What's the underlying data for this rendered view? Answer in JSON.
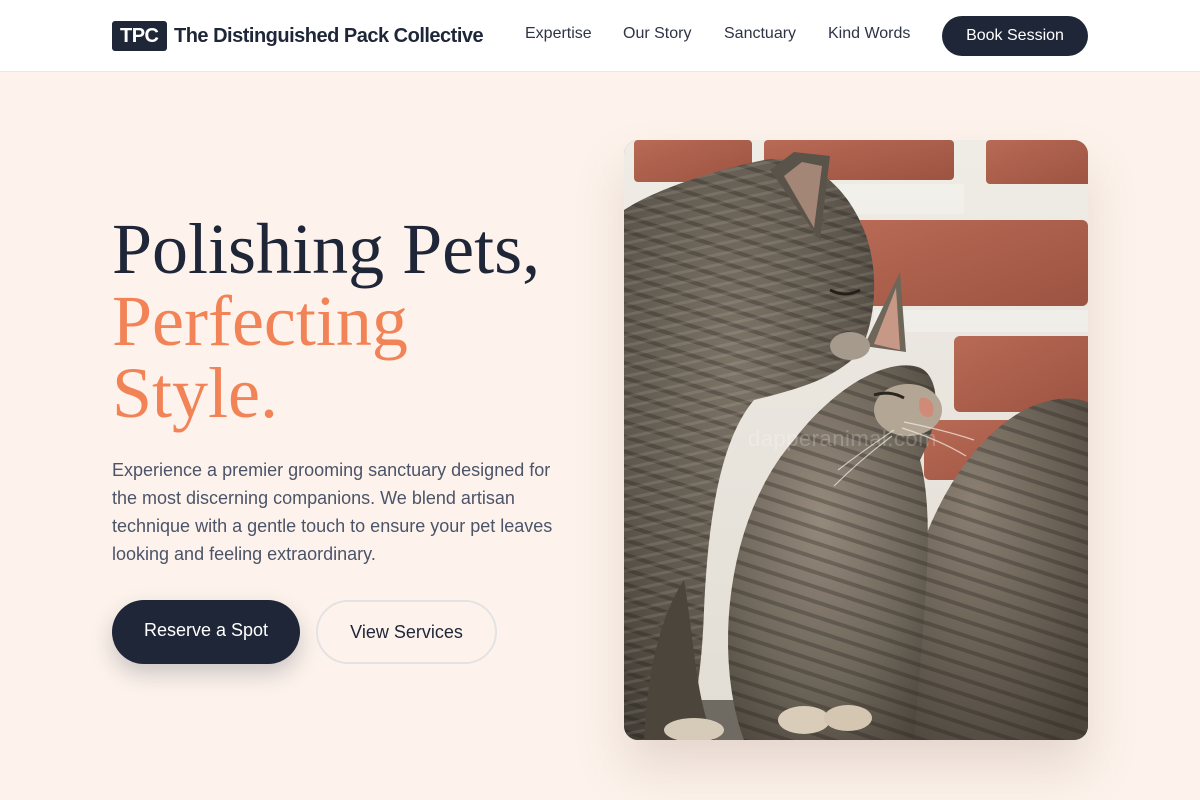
{
  "header": {
    "logo_text": "TPC",
    "brand_name": "The Distinguished Pack Collective",
    "nav": [
      {
        "label": "Expertise"
      },
      {
        "label": "Our Story"
      },
      {
        "label": "Sanctuary"
      },
      {
        "label": "Kind Words"
      }
    ],
    "cta_label": "Book Session"
  },
  "hero": {
    "headline_line1": "Polishing Pets,",
    "headline_line2": "Perfecting",
    "headline_line3": "Style.",
    "description": "Experience a premier grooming sanctuary designed for the most discerning companions. We blend artisan technique with a gentle touch to ensure your pet leaves looking and feeling extraordinary.",
    "primary_button": "Reserve a Spot",
    "secondary_button": "View Services"
  },
  "photo": {
    "subject": "two tabby cats nuzzling in front of a brick wall",
    "watermark": "dapperanimal.com"
  },
  "colors": {
    "navy": "#1e2638",
    "accent_coral": "#f28357",
    "page_background": "#fdf3ec",
    "header_background": "#ffffff"
  }
}
